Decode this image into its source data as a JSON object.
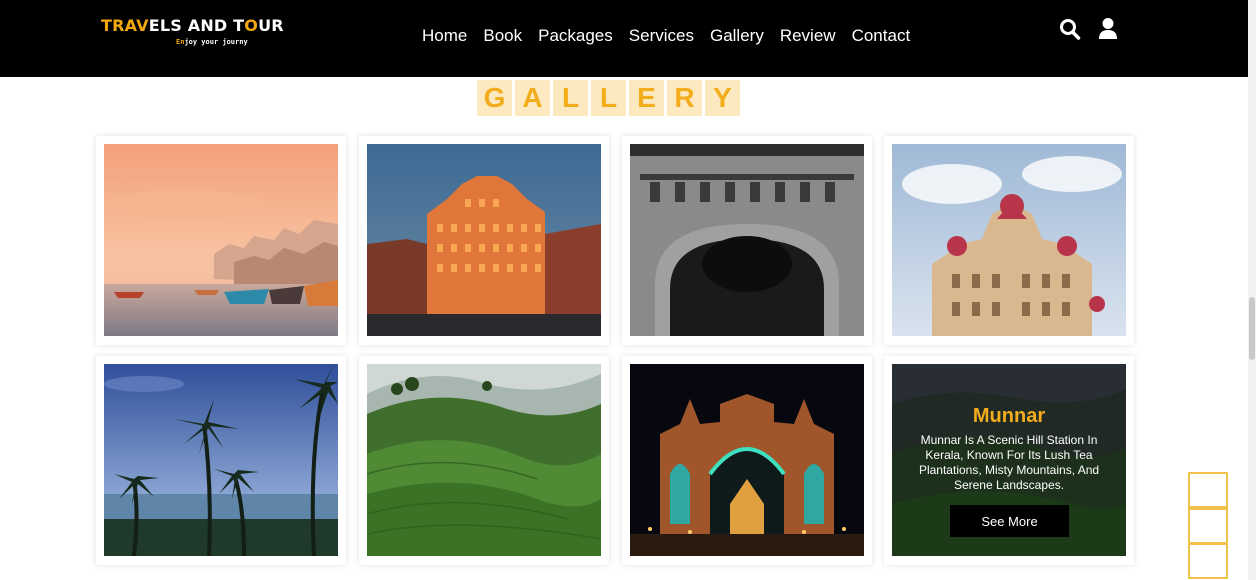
{
  "header": {
    "logo": {
      "title_part1": "TRAV",
      "title_part2": "ELS AND T",
      "title_part3": "O",
      "title_part4": "UR",
      "tagline_part1": "En",
      "tagline_part2": "joy your journy"
    },
    "nav": [
      "Home",
      "Book",
      "Packages",
      "Services",
      "Gallery",
      "Review",
      "Contact"
    ],
    "icons": {
      "search": "search-icon",
      "user": "user-icon"
    }
  },
  "gallery": {
    "title_letters": [
      "G",
      "A",
      "L",
      "L",
      "E",
      "R",
      "Y"
    ],
    "items": [
      {
        "scene": "varanasi-ghats-sunset"
      },
      {
        "scene": "hawa-mahal-night"
      },
      {
        "scene": "gateway-arch-monochrome"
      },
      {
        "scene": "mysore-palace-day"
      },
      {
        "scene": "beach-palm-trees"
      },
      {
        "scene": "tea-plantation-hills"
      },
      {
        "scene": "mysore-palace-night"
      },
      {
        "scene": "munnar-hills",
        "overlay": {
          "title": "Munnar",
          "description": "Munnar Is A Scenic Hill Station In Kerala, Known For Its Lush Tea Plantations, Misty Mountains, And Serene Landscapes.",
          "button": "See More"
        }
      }
    ]
  },
  "colors": {
    "accent": "#f3ac1c",
    "header_bg": "#000000",
    "title_tile_bg": "#fde9c0"
  }
}
